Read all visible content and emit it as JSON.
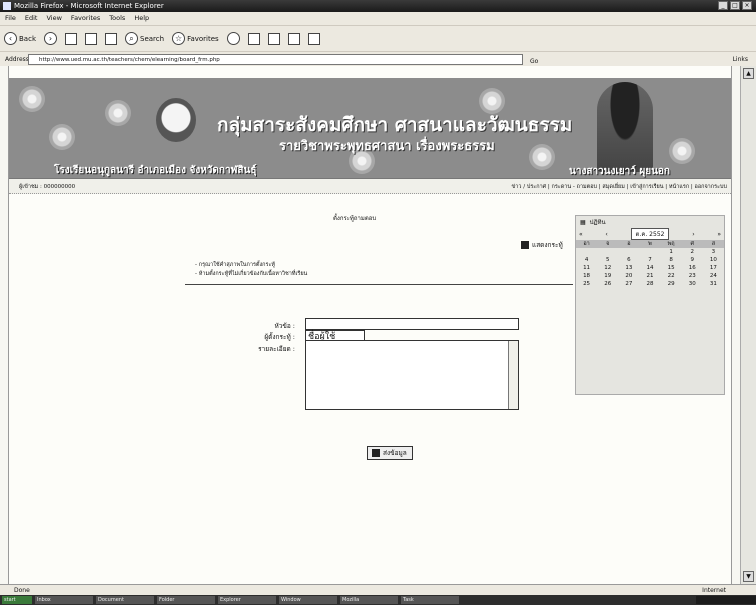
{
  "window": {
    "title": "Mozilla Firefox - Microsoft Internet Explorer"
  },
  "menu": [
    "File",
    "Edit",
    "View",
    "Favorites",
    "Tools",
    "Help"
  ],
  "toolbar": {
    "back": "Back",
    "search": "Search",
    "favorites": "Favorites"
  },
  "address": {
    "label": "Address",
    "url": "http://www.ued.mu.ac.th/teachers/chem/elearning/board_frm.php",
    "go": "Go",
    "links": "Links"
  },
  "banner": {
    "title": "กลุ่มสาระสังคมศึกษา ศาสนาและวัฒนธรรม",
    "subtitle": "รายวิชาพระพุทธศาสนา เรื่องพระธรรม",
    "school": "โรงเรียนอนุกูลนารี อำเภอเมือง จังหวัดกาฬสินธุ์",
    "teacher": "นางสาวนงเยาว์ ผุยนอก"
  },
  "nav": {
    "visitor": "ผู้เข้าชม : 000000000",
    "links": "ข่าว / ประกาศ | กระดาน - ถามตอบ | สมุดเยี่ยม | เข้าสู่การเรียน | หน้าแรก | ออกจากระบบ"
  },
  "board": {
    "title": "ตั้งกระทู้ถามตอบ",
    "home_link": "แสดงกระทู้",
    "notes": [
      "- กรุณาใช้คำสุภาพในการตั้งกระทู้",
      "- ห้ามตั้งกระทู้ที่ไม่เกี่ยวข้องกับเนื้อหาวิชาที่เรียน"
    ],
    "labels": {
      "topic": "หัวข้อ :",
      "name": "ผู้ตั้งกระทู้ :",
      "detail": "รายละเอียด :"
    },
    "name_value": "ชื่อผู้ใช้",
    "submit": "ส่งข้อมูล"
  },
  "calendar": {
    "label": "ปฏิทิน",
    "month": "ต.ค. 2552",
    "days": [
      "อา",
      "จ",
      "อ",
      "พ",
      "พฤ",
      "ศ",
      "ส"
    ],
    "weeks": [
      [
        "",
        "",
        "",
        "",
        "1",
        "2",
        "3"
      ],
      [
        "4",
        "5",
        "6",
        "7",
        "8",
        "9",
        "10"
      ],
      [
        "11",
        "12",
        "13",
        "14",
        "15",
        "16",
        "17"
      ],
      [
        "18",
        "19",
        "20",
        "21",
        "22",
        "23",
        "24"
      ],
      [
        "25",
        "26",
        "27",
        "28",
        "29",
        "30",
        "31"
      ]
    ]
  },
  "status": {
    "text": "Done",
    "zone": "Internet"
  },
  "taskbar": [
    "start",
    "Inbox",
    "Document",
    "Folder",
    "Explorer",
    "Window",
    "Mozilla",
    "Task"
  ]
}
